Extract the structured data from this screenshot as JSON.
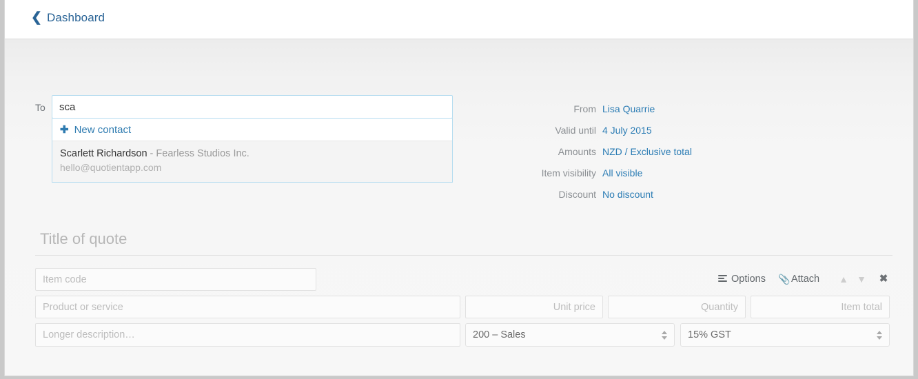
{
  "topbar": {
    "back_label": "Dashboard",
    "back_icon": "chevron-left-icon"
  },
  "recipient": {
    "label": "To",
    "value": "sca",
    "placeholder": "",
    "dropdown": {
      "new_contact_label": "New contact",
      "new_contact_icon": "plus-icon",
      "results": [
        {
          "name": "Scarlett Richardson",
          "company": " - Fearless Studios Inc.",
          "email": "hello@quotientapp.com"
        }
      ]
    }
  },
  "meta": {
    "rows": [
      {
        "label": "From",
        "value": "Lisa Quarrie"
      },
      {
        "label": "Valid until",
        "value": "4 July 2015"
      },
      {
        "label": "Amounts",
        "value": "NZD / Exclusive total"
      },
      {
        "label": "Item visibility",
        "value": "All visible"
      },
      {
        "label": "Discount",
        "value": "No discount"
      }
    ]
  },
  "quote": {
    "title_value": "",
    "title_placeholder": "Title of quote"
  },
  "line_item": {
    "item_code_placeholder": "Item code",
    "item_code_value": "",
    "product_placeholder": "Product or service",
    "product_value": "",
    "unit_price_placeholder": "Unit price",
    "unit_price_value": "",
    "quantity_placeholder": "Quantity",
    "quantity_value": "",
    "item_total_placeholder": "Item total",
    "item_total_value": "",
    "description_placeholder": "Longer description…",
    "description_value": "",
    "account_selected": "200 – Sales",
    "tax_selected": "15% GST",
    "toolbar": {
      "options_label": "Options",
      "options_icon": "list-bars-icon",
      "attach_label": "Attach",
      "attach_icon": "paperclip-icon",
      "move_up_icon": "chevron-up-icon",
      "move_down_icon": "chevron-down-icon",
      "remove_icon": "close-x-icon"
    }
  },
  "colors": {
    "link_blue": "#2a6496",
    "value_blue": "#2b7cb4",
    "focus_border": "#b5dcf0",
    "page_bg": "#f7f7f7"
  }
}
